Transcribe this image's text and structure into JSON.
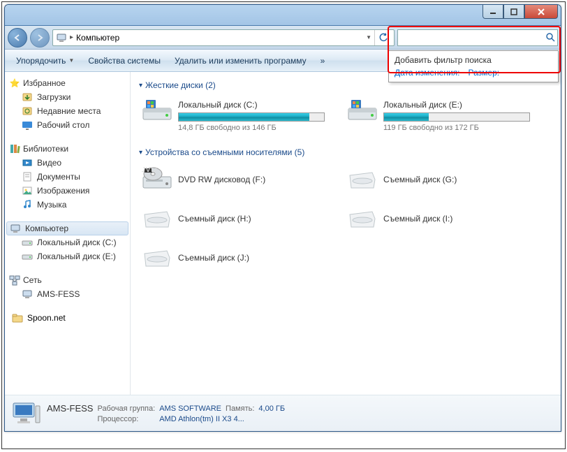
{
  "titlebar": {},
  "address": {
    "location": "Компьютер"
  },
  "search": {
    "value": "",
    "dd_title": "Добавить фильтр поиска",
    "filter_date": "Дата изменения:",
    "filter_size": "Размер:"
  },
  "toolbar": {
    "organize": "Упорядочить",
    "properties": "Свойства системы",
    "uninstall": "Удалить или изменить программу",
    "chevron": "»"
  },
  "sidebar": {
    "favorites": {
      "label": "Избранное",
      "items": [
        "Загрузки",
        "Недавние места",
        "Рабочий стол"
      ]
    },
    "libraries": {
      "label": "Библиотеки",
      "items": [
        "Видео",
        "Документы",
        "Изображения",
        "Музыка"
      ]
    },
    "computer": {
      "label": "Компьютер",
      "items": [
        "Локальный диск (C:)",
        "Локальный диск (E:)"
      ]
    },
    "network": {
      "label": "Сеть",
      "items": [
        "AMS-FESS"
      ]
    },
    "spoon": "Spoon.net"
  },
  "content": {
    "hdd_header": "Жесткие диски (2)",
    "hdd": [
      {
        "name": "Локальный диск (C:)",
        "free": "14,8 ГБ свободно из 146 ГБ",
        "pct": 90
      },
      {
        "name": "Локальный диск (E:)",
        "free": "119 ГБ свободно из 172 ГБ",
        "pct": 31
      }
    ],
    "removable_header": "Устройства со съемными носителями (5)",
    "removable": [
      {
        "name": "DVD RW дисковод (F:)",
        "type": "dvd"
      },
      {
        "name": "Съемный диск (G:)",
        "type": "removable"
      },
      {
        "name": "Съемный диск (H:)",
        "type": "removable"
      },
      {
        "name": "Съемный диск (I:)",
        "type": "removable"
      },
      {
        "name": "Съемный диск (J:)",
        "type": "removable"
      }
    ]
  },
  "details": {
    "name": "AMS-FESS",
    "workgroup_label": "Рабочая группа:",
    "workgroup": "AMS SOFTWARE",
    "memory_label": "Память:",
    "memory": "4,00 ГБ",
    "cpu_label": "Процессор:",
    "cpu": "AMD Athlon(tm) II X3 4..."
  }
}
